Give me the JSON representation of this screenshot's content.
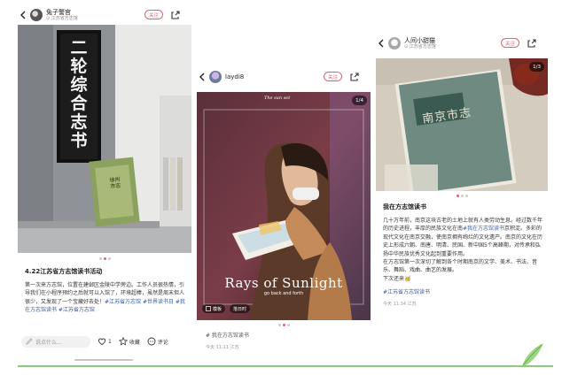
{
  "posts": [
    {
      "author": "兔子警官",
      "location": "江苏省方志馆",
      "follow_label": "关注",
      "pager": [
        "",
        "on",
        ""
      ],
      "title": "4.22江苏省方志馆读书活动",
      "body": "第一次来方志馆，位置在建邺区金陵中学旁边。工作人员很热情，引导我们在小程序预约之后就可以入馆了，环境超棒，虽然是周末但人很少，又发现了一个宝藏好去处！",
      "tags": "#江苏省方志馆 #世界读书日 #我在方志馆读书 #江苏省方志馆",
      "sign_text": "二轮综合志书",
      "book_title": "徐州市志",
      "comment_placeholder": "说点什么...",
      "like_count": "1",
      "collect_label": "收藏",
      "comment_label": "评论"
    },
    {
      "author": "laydi8",
      "follow_label": "关注",
      "counter": "1/4",
      "overlay_small": "The sun set",
      "overlay_big": "Rays of Sunlight",
      "overlay_sub": "go back and forth",
      "template_label": "模板",
      "mode_label": "落日时",
      "pager": [
        "",
        "on",
        ""
      ],
      "tags": "# 我在方志馆读书",
      "footer": "今天 11:11 江苏"
    },
    {
      "author": "人间小甜猫",
      "location": "江苏省方志馆",
      "follow_label": "关注",
      "counter": "1/3",
      "book_title": "南京市志",
      "pager": [
        "on",
        "",
        ""
      ],
      "title": "我在方志馆读书",
      "body": "几十万年前，南京这块古老的土地上就有人类劳动生息。经过数千年的历史进程，丰厚的民族文化在南",
      "body_tag": "#我在方志馆读书",
      "body2": "京积淀。多彩的现代文化在南京交融，使南京拥有绚烂的文化遗产。南京的文化在历史上形成六朝、南唐、明清、民国、新中国5个高峰期，对传承和弘扬中华民族优秀文化起到重要作用。",
      "body3": "在方志馆第一次深切了解到各个时期南京的文学、美术、书法、音乐、舞蹈、戏曲、曲艺的发展。",
      "body4": "下次还来🥳",
      "tags": "#江苏省方志馆读书",
      "footer": "今天 11:34 江苏"
    }
  ],
  "colors": {
    "accent": "#f15c6c",
    "tag": "#3b5da8",
    "leaf": "#6fbf5a"
  }
}
